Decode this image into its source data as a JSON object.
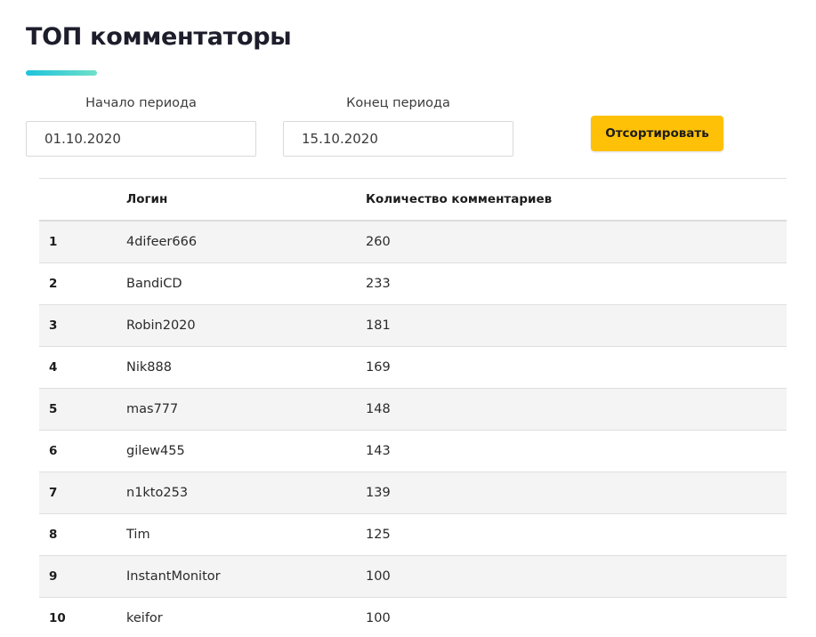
{
  "page": {
    "title": "ТОП комментаторы",
    "accent_gradient": [
      "#1ec3dc",
      "#6fe0c8"
    ]
  },
  "filters": {
    "start_label": "Начало периода",
    "start_value": "01.10.2020",
    "end_label": "Конец периода",
    "end_value": "15.10.2020",
    "sort_label": "Отсортировать",
    "sort_color": "#ffc107"
  },
  "table": {
    "headers": {
      "rank": "",
      "login": "Логин",
      "count": "Количество комментариев"
    },
    "rows": [
      {
        "rank": "1",
        "login": "4difeer666",
        "count": "260"
      },
      {
        "rank": "2",
        "login": "BandiCD",
        "count": "233"
      },
      {
        "rank": "3",
        "login": "Robin2020",
        "count": "181"
      },
      {
        "rank": "4",
        "login": "Nik888",
        "count": "169"
      },
      {
        "rank": "5",
        "login": "mas777",
        "count": "148"
      },
      {
        "rank": "6",
        "login": "gilew455",
        "count": "143"
      },
      {
        "rank": "7",
        "login": "n1kto253",
        "count": "139"
      },
      {
        "rank": "8",
        "login": "Tim",
        "count": "125"
      },
      {
        "rank": "9",
        "login": "InstantMonitor",
        "count": "100"
      },
      {
        "rank": "10",
        "login": "keifor",
        "count": "100"
      }
    ]
  }
}
